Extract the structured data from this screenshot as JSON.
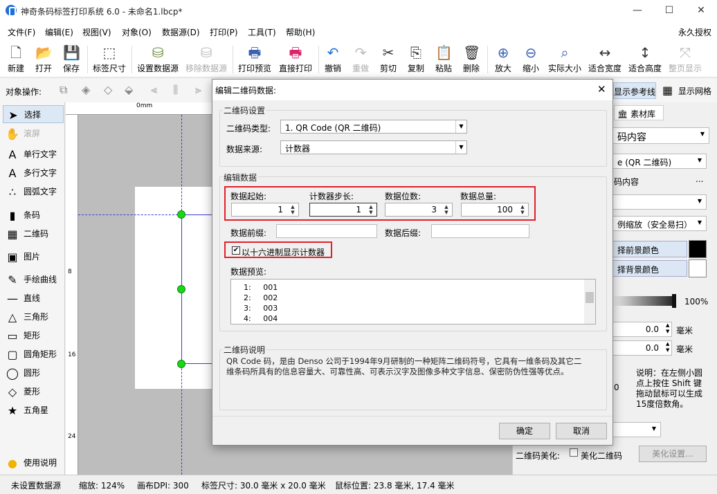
{
  "window": {
    "title": "神奇条码标签打印系统 6.0 - 未命名1.lbcp*",
    "min": "—",
    "max": "☐",
    "close": "✕"
  },
  "menu": {
    "items": [
      "文件(F)",
      "编辑(E)",
      "视图(V)",
      "对象(O)",
      "数据源(D)",
      "打印(P)",
      "工具(T)",
      "帮助(H)"
    ],
    "license": "永久授权"
  },
  "toolbar": {
    "items": [
      {
        "label": "新建",
        "icon": "new-file-icon",
        "glyph": "🗋"
      },
      {
        "label": "打开",
        "icon": "open-icon",
        "glyph": "📂"
      },
      {
        "label": "保存",
        "icon": "save-icon",
        "glyph": "💾"
      },
      {
        "label": "标签尺寸",
        "icon": "label-size-icon",
        "glyph": "⬚"
      },
      {
        "label": "设置数据源",
        "icon": "database-icon",
        "glyph": "⛁"
      },
      {
        "label": "移除数据源",
        "icon": "remove-database-icon",
        "glyph": "⛁"
      },
      {
        "label": "打印预览",
        "icon": "print-preview-icon",
        "glyph": "🖶"
      },
      {
        "label": "直接打印",
        "icon": "print-icon",
        "glyph": "🖶"
      },
      {
        "label": "撤销",
        "icon": "undo-icon",
        "glyph": "↶"
      },
      {
        "label": "重做",
        "icon": "redo-icon",
        "glyph": "↷"
      },
      {
        "label": "剪切",
        "icon": "cut-icon",
        "glyph": "✂"
      },
      {
        "label": "复制",
        "icon": "copy-icon",
        "glyph": "⎘"
      },
      {
        "label": "粘贴",
        "icon": "paste-icon",
        "glyph": "📋"
      },
      {
        "label": "删除",
        "icon": "delete-icon",
        "glyph": "🗑"
      },
      {
        "label": "放大",
        "icon": "zoom-in-icon",
        "glyph": "⊕"
      },
      {
        "label": "缩小",
        "icon": "zoom-out-icon",
        "glyph": "⊖"
      },
      {
        "label": "实际大小",
        "icon": "actual-size-icon",
        "glyph": "⌕"
      },
      {
        "label": "适合宽度",
        "icon": "fit-width-icon",
        "glyph": "↔"
      },
      {
        "label": "适合高度",
        "icon": "fit-height-icon",
        "glyph": "↕"
      },
      {
        "label": "整页显示",
        "icon": "full-page-icon",
        "glyph": "⤧"
      }
    ]
  },
  "objbar": {
    "label": "对象操作:",
    "show_ref_line": "显示参考线",
    "show_grid": "显示网格"
  },
  "tools": {
    "items": [
      {
        "label": "选择",
        "glyph": "➤"
      },
      {
        "label": "滚屏",
        "glyph": "✋"
      },
      {
        "label": "单行文字",
        "glyph": "A"
      },
      {
        "label": "多行文字",
        "glyph": "A"
      },
      {
        "label": "圆弧文字",
        "glyph": "∴"
      },
      {
        "label": "条码",
        "glyph": "▮"
      },
      {
        "label": "二维码",
        "glyph": "▦"
      },
      {
        "label": "图片",
        "glyph": "▣"
      },
      {
        "label": "手绘曲线",
        "glyph": "✎"
      },
      {
        "label": "直线",
        "glyph": "—"
      },
      {
        "label": "三角形",
        "glyph": "△"
      },
      {
        "label": "矩形",
        "glyph": "▭"
      },
      {
        "label": "圆角矩形",
        "glyph": "▢"
      },
      {
        "label": "圆形",
        "glyph": "◯"
      },
      {
        "label": "菱形",
        "glyph": "◇"
      },
      {
        "label": "五角星",
        "glyph": "★"
      }
    ],
    "help": "使用说明"
  },
  "ruler": {
    "zero": "0mm",
    "marks": [
      "8",
      "16",
      "24"
    ]
  },
  "right": {
    "tab": "素材库",
    "content_select": "码内容",
    "type_select": "e (QR 二维码)",
    "content_label": "码内容",
    "more": "...",
    "scale_select": "例缩放（安全易扫）",
    "fg_color": "择前景颜色",
    "bg_color": "择背景颜色",
    "opacity": "100%",
    "val1": "0.0",
    "unit1": "毫米",
    "val2": "0.0",
    "unit2": "毫米",
    "zero": "0",
    "note": "说明：在左侧小圆点上按住 Shift 键拖动鼠标可以生成15度倍数角。",
    "beautify_label": "二维码美化:",
    "beautify_check": "美化二维码",
    "beautify_btn": "美化设置...",
    "fg_hex": "#000000",
    "bg_hex": "#ffffff"
  },
  "status": {
    "datasource": "未设置数据源",
    "zoom": "缩放: 124%",
    "dpi": "画布DPI: 300",
    "size": "标签尺寸: 30.0 毫米 x 20.0 毫米",
    "mouse": "鼠标位置: 23.8 毫米, 17.4 毫米"
  },
  "dialog": {
    "title": "编辑二维码数据:",
    "group_settings": "二维码设置",
    "type_label": "二维码类型:",
    "type_value": "1.  QR Code (QR 二维码)",
    "source_label": "数据来源:",
    "source_value": "计数器",
    "group_edit": "编辑数据",
    "start_label": "数据起始:",
    "start_value": "1",
    "step_label": "计数器步长:",
    "step_value": "1",
    "digits_label": "数据位数:",
    "digits_value": "3",
    "total_label": "数据总量:",
    "total_value": "100",
    "prefix_label": "数据前缀:",
    "suffix_label": "数据后缀:",
    "hex_label": "以十六进制显示计数器",
    "preview_label": "数据预览:",
    "preview": [
      {
        "n": "1:",
        "v": "001"
      },
      {
        "n": "2:",
        "v": "002"
      },
      {
        "n": "3:",
        "v": "003"
      },
      {
        "n": "4:",
        "v": "004"
      }
    ],
    "group_desc": "二维码说明",
    "desc": "QR Code 码，是由 Denso 公司于1994年9月研制的一种矩阵二维码符号，它具有一维条码及其它二维条码所具有的信息容量大、可靠性高、可表示汉字及图像多种文字信息、保密防伪性强等优点。",
    "ok": "确定",
    "cancel": "取消"
  },
  "colors": {
    "accent": "#1e6fd9",
    "highlight": "#e0202a",
    "handle": "#19d619"
  }
}
